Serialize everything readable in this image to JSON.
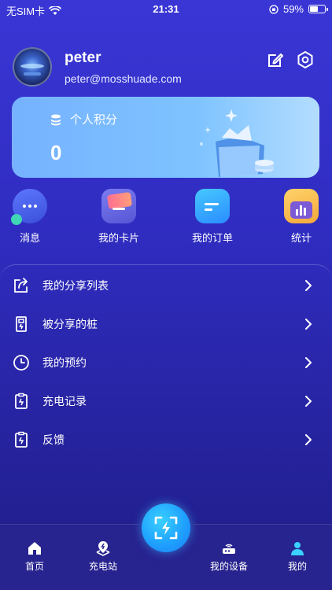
{
  "status_bar": {
    "carrier": "无SIM卡",
    "time": "21:31",
    "battery_percent": "59%",
    "battery_level": 0.59
  },
  "profile": {
    "username": "peter",
    "email": "peter@mosshuade.com"
  },
  "points_card": {
    "label": "个人积分",
    "value": "0"
  },
  "shortcuts": [
    {
      "label": "消息",
      "icon": "message-icon"
    },
    {
      "label": "我的卡片",
      "icon": "card-icon"
    },
    {
      "label": "我的订单",
      "icon": "order-icon"
    },
    {
      "label": "统计",
      "icon": "stats-icon"
    }
  ],
  "menu": [
    {
      "label": "我的分享列表",
      "icon": "share-icon"
    },
    {
      "label": "被分享的桩",
      "icon": "charger-icon"
    },
    {
      "label": "我的预约",
      "icon": "clock-icon"
    },
    {
      "label": "充电记录",
      "icon": "record-icon"
    },
    {
      "label": "反馈",
      "icon": "feedback-icon"
    }
  ],
  "tabbar": {
    "home": "首页",
    "stations": "充电站",
    "devices": "我的设备",
    "mine": "我的"
  },
  "colors": {
    "background": "#2f2cc0",
    "card": "#7ec3ff",
    "accent": "#1fa1ff",
    "active_tab": "#3ad0ff"
  }
}
